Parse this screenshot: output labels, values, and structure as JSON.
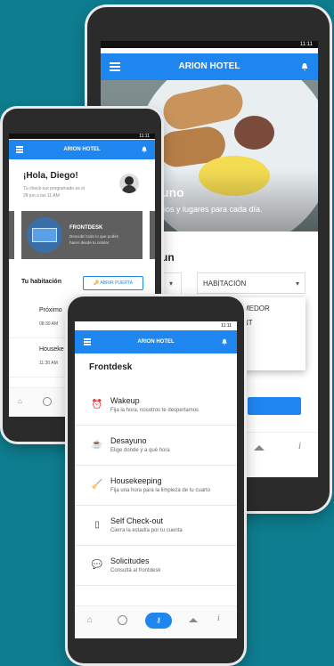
{
  "status_time": "11:11",
  "app_title": "ARION HOTEL",
  "back_phone": {
    "hero_text_1": "uno",
    "hero_text_2": "rios y lugares para cada día.",
    "section_prefix": "un",
    "dropdown_label": "HABITACIÓN",
    "options": [
      "MEDOR",
      "NT"
    ]
  },
  "middle_phone": {
    "greeting": "¡Hola, Diego!",
    "checkout_line_1": "Tu check-out programado es el",
    "checkout_line_2": "28 jun a las 11 AM",
    "card_title": "FRONTDESK",
    "card_desc_1": "Descubrí todo lo que podés",
    "card_desc_2": "hacer desde tu celular",
    "room_label": "Tu habitación",
    "open_door_label": "ABRIR PUERTA",
    "items": [
      {
        "title": "Próximo",
        "time": "08:30 AM"
      },
      {
        "title": "Houseke",
        "time": "11:30 AM"
      }
    ]
  },
  "front_phone": {
    "page_title": "Frontdesk",
    "items": [
      {
        "title": "Wakeup",
        "desc": "Fija la hora, nosotros te despertamos",
        "icon": "alarm-icon"
      },
      {
        "title": "Desayuno",
        "desc": "Elige donde y a qué hora",
        "icon": "coffee-icon"
      },
      {
        "title": "Housekeeping",
        "desc": "Fija una hora para la limpieza de tu cuarto",
        "icon": "broom-icon"
      },
      {
        "title": "Self Check-out",
        "desc": "Cierra la estadía por tu cuenta",
        "icon": "door-icon"
      },
      {
        "title": "Solicitudes",
        "desc": "Consultá al frontdesk",
        "icon": "chat-icon"
      }
    ],
    "nav": [
      "home-icon",
      "profile-icon",
      "key-icon",
      "bell-fold-icon",
      "info-icon"
    ]
  },
  "colors": {
    "brand": "#1f86f0",
    "background": "#0e7d8f"
  }
}
